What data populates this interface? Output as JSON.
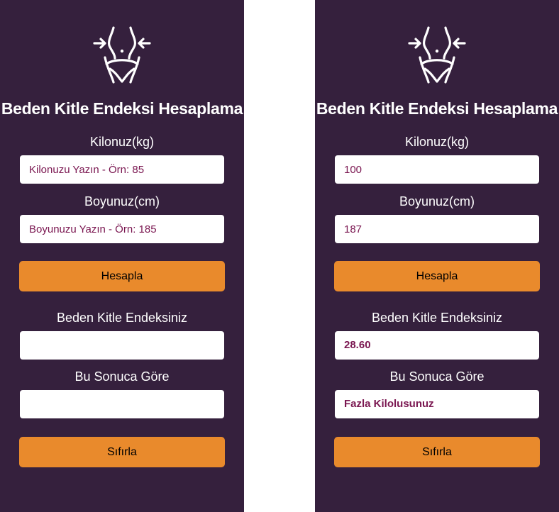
{
  "screens": [
    {
      "title": "Beden Kitle Endeksi Hesaplama",
      "weight_label": "Kilonuz(kg)",
      "weight_value": "",
      "weight_placeholder": "Kilonuzu Yazın - Örn: 85",
      "height_label": "Boyunuz(cm)",
      "height_value": "",
      "height_placeholder": "Boyunuzu Yazın - Örn: 185",
      "calculate_label": "Hesapla",
      "bmi_label": "Beden Kitle Endeksiniz",
      "bmi_value": "",
      "result_label": "Bu Sonuca Göre",
      "result_value": "",
      "reset_label": "Sıfırla",
      "logo_icon": "waist-slim-icon"
    },
    {
      "title": "Beden Kitle Endeksi Hesaplama",
      "weight_label": "Kilonuz(kg)",
      "weight_value": "100",
      "weight_placeholder": "Kilonuzu Yazın - Örn: 85",
      "height_label": "Boyunuz(cm)",
      "height_value": "187",
      "height_placeholder": "Boyunuzu Yazın - Örn: 185",
      "calculate_label": "Hesapla",
      "bmi_label": "Beden Kitle Endeksiniz",
      "bmi_value": "28.60",
      "result_label": "Bu Sonuca Göre",
      "result_value": "Fazla Kilolusunuz",
      "reset_label": "Sıfırla",
      "logo_icon": "waist-slim-icon"
    }
  ],
  "colors": {
    "panel_background": "#35203d",
    "button_background": "#e98a2c",
    "input_text": "#7a1650",
    "page_background": "#ffffff"
  }
}
